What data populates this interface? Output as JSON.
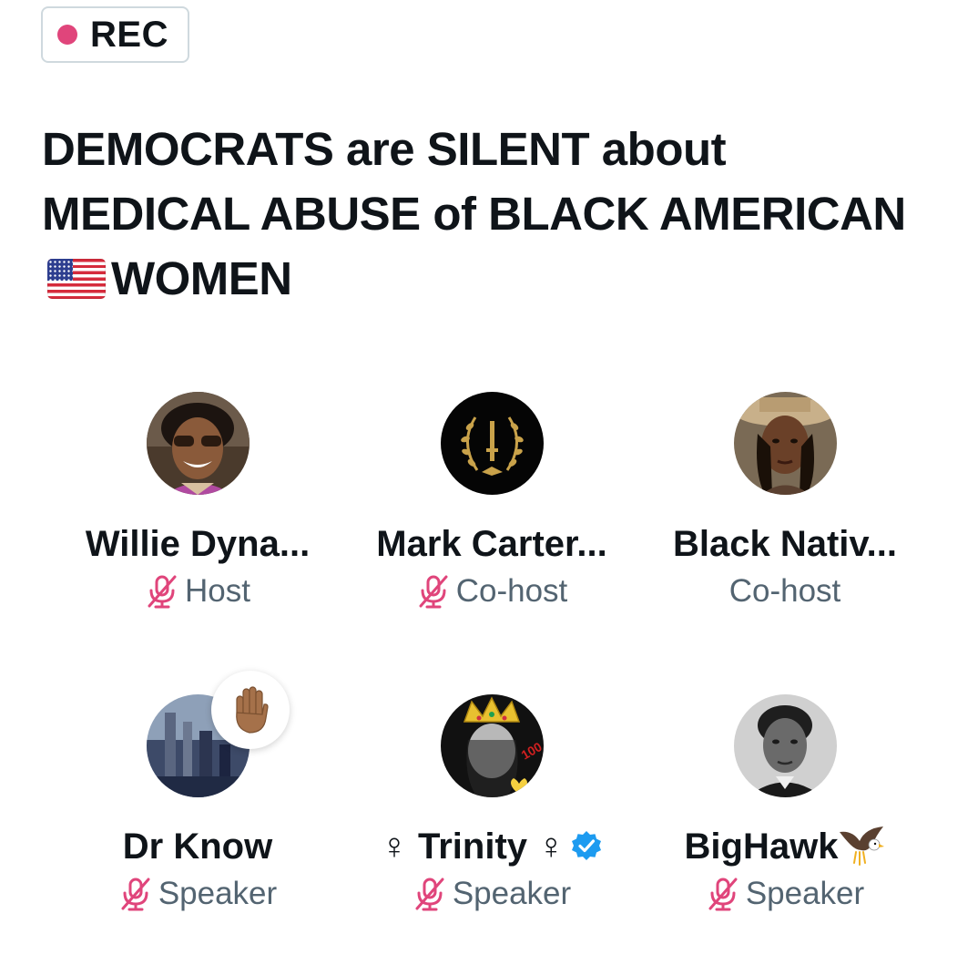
{
  "recording": {
    "label": "REC",
    "dot_color": "#e0457b"
  },
  "space": {
    "title_part1": "DEMOCRATS are SILENT about MEDICAL ABUSE of BLACK AMERICAN",
    "title_flag": "us-flag-icon",
    "title_part2": "WOMEN"
  },
  "participants": [
    {
      "name": "Willie Dyna...",
      "role": "Host",
      "muted": true,
      "avatar": "man-sunglasses-avatar"
    },
    {
      "name": "Mark Carter...",
      "role": "Co-host",
      "muted": true,
      "avatar": "laurel-wreath-avatar"
    },
    {
      "name": "Black Nativ...",
      "role": "Co-host",
      "muted": false,
      "avatar": "woman-hat-avatar"
    },
    {
      "name": "Dr Know",
      "role": "Speaker",
      "muted": true,
      "avatar": "city-avatar",
      "hand_raised": true
    },
    {
      "name_prefix": "♀",
      "name": "Trinity",
      "name_suffix": "♀",
      "role": "Speaker",
      "muted": true,
      "verified": true,
      "avatar": "crown-avatar"
    },
    {
      "name": "BigHawk",
      "role": "Speaker",
      "muted": true,
      "avatar": "portrait-avatar",
      "name_icon": "eagle-icon"
    }
  ],
  "colors": {
    "mute_icon": "#e0457b",
    "role_text": "#536471",
    "verified": "#1d9bf0",
    "text": "#0f1419"
  }
}
